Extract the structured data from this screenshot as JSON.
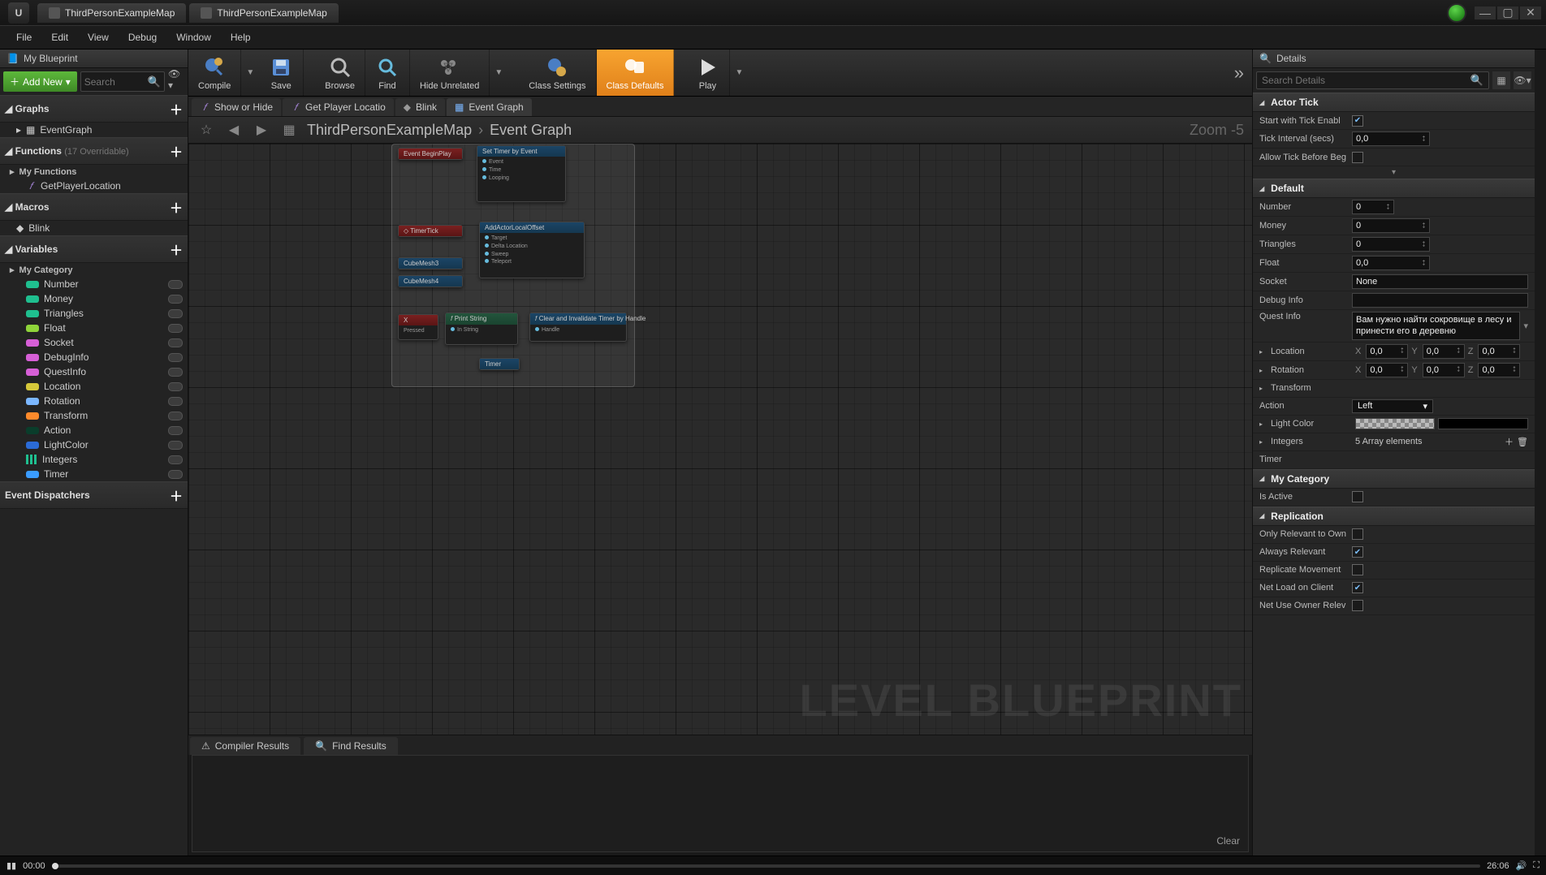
{
  "titleTabs": [
    "ThirdPersonExampleMap",
    "ThirdPersonExampleMap"
  ],
  "menu": [
    "File",
    "Edit",
    "View",
    "Debug",
    "Window",
    "Help"
  ],
  "leftPanel": {
    "title": "My Blueprint",
    "addNew": "Add New",
    "searchPlaceholder": "Search",
    "sections": {
      "graphs": "Graphs",
      "eventGraph": "EventGraph",
      "functions": "Functions",
      "functionsOverride": "(17 Overridable)",
      "myFunctions": "My Functions",
      "getPlayerLocation": "GetPlayerLocation",
      "macros": "Macros",
      "blink": "Blink",
      "variables": "Variables",
      "myCategory": "My Category",
      "eventDispatchers": "Event Dispatchers"
    },
    "vars": [
      {
        "name": "Number",
        "color": "#1fbf8f"
      },
      {
        "name": "Money",
        "color": "#1fbf8f"
      },
      {
        "name": "Triangles",
        "color": "#1fbf8f"
      },
      {
        "name": "Float",
        "color": "#8fd43a"
      },
      {
        "name": "Socket",
        "color": "#d65fd6"
      },
      {
        "name": "DebugInfo",
        "color": "#d65fd6"
      },
      {
        "name": "QuestInfo",
        "color": "#d65fd6"
      },
      {
        "name": "Location",
        "color": "#d6c83a"
      },
      {
        "name": "Rotation",
        "color": "#7bb7ff"
      },
      {
        "name": "Transform",
        "color": "#ff8a2b"
      },
      {
        "name": "Action",
        "color": "#0a3d2b"
      },
      {
        "name": "LightColor",
        "color": "#2b6bd6"
      },
      {
        "name": "Integers",
        "color": "#1fbf8f",
        "grid": true
      },
      {
        "name": "Timer",
        "color": "#3a9cff"
      }
    ]
  },
  "toolbar": [
    {
      "label": "Compile",
      "icon": "compile"
    },
    {
      "label": "Save",
      "icon": "save"
    },
    {
      "label": "Browse",
      "icon": "browse"
    },
    {
      "label": "Find",
      "icon": "find"
    },
    {
      "label": "Hide Unrelated",
      "icon": "hide"
    },
    {
      "label": "Class Settings",
      "icon": "classset"
    },
    {
      "label": "Class Defaults",
      "icon": "classdef",
      "active": true
    },
    {
      "label": "Play",
      "icon": "play"
    }
  ],
  "openGraphs": [
    {
      "label": "Show or Hide",
      "icon": "fn"
    },
    {
      "label": "Get Player Locatio",
      "icon": "fn"
    },
    {
      "label": "Blink",
      "icon": "macro"
    },
    {
      "label": "Event Graph",
      "icon": "graph",
      "active": true
    }
  ],
  "graphHeader": {
    "crumbRoot": "ThirdPersonExampleMap",
    "crumbLeaf": "Event Graph",
    "zoom": "Zoom -5"
  },
  "watermark": "LEVEL BLUEPRINT",
  "nodes": {
    "beginPlay": "Event BeginPlay",
    "setTimer": "Set Timer by Event",
    "timerTick": "TimerTick",
    "addOffset": "AddActorLocalOffset",
    "target": "Target",
    "delta": "Delta Location",
    "sweep": "Sweep",
    "teleport": "Teleport",
    "cubeMesh1": "CubeMesh3",
    "cubeMesh2": "CubeMesh4",
    "keyX": "X",
    "printStr": "Print String",
    "clearTimer": "Clear and Invalidate Timer by Handle",
    "handle": "Handle",
    "pressed": "Pressed",
    "timerVar": "Timer"
  },
  "bottomTabs": {
    "compiler": "Compiler Results",
    "find": "Find Results",
    "clear": "Clear"
  },
  "details": {
    "title": "Details",
    "searchPlaceholder": "Search Details",
    "actorTick": {
      "head": "Actor Tick",
      "startTick": "Start with Tick Enabl",
      "tickInterval": "Tick Interval (secs)",
      "tickIntervalVal": "0,0",
      "allowBefore": "Allow Tick Before Beg"
    },
    "default": {
      "head": "Default",
      "number": "Number",
      "numberVal": "0",
      "money": "Money",
      "moneyVal": "0",
      "triangles": "Triangles",
      "trianglesVal": "0",
      "float": "Float",
      "floatVal": "0,0",
      "socket": "Socket",
      "socketVal": "None",
      "debugInfo": "Debug Info",
      "debugVal": "",
      "questInfo": "Quest Info",
      "questVal": "Вам нужно найти сокровище в лесу и принести его в деревню",
      "location": "Location",
      "rotation": "Rotation",
      "transform": "Transform",
      "action": "Action",
      "actionVal": "Left",
      "lightColor": "Light Color",
      "integers": "Integers",
      "integersVal": "5 Array elements",
      "timer": "Timer"
    },
    "axis": {
      "x": "X",
      "y": "Y",
      "z": "Z",
      "val": "0,0"
    },
    "myCategory": {
      "head": "My Category",
      "isActive": "Is Active"
    },
    "replication": {
      "head": "Replication",
      "onlyRel": "Only Relevant to Own",
      "alwaysRel": "Always Relevant",
      "repMove": "Replicate Movement",
      "netLoad": "Net Load on Client",
      "netUse": "Net Use Owner Relev"
    }
  },
  "video": {
    "cur": "00:00",
    "dur": "26:06"
  }
}
